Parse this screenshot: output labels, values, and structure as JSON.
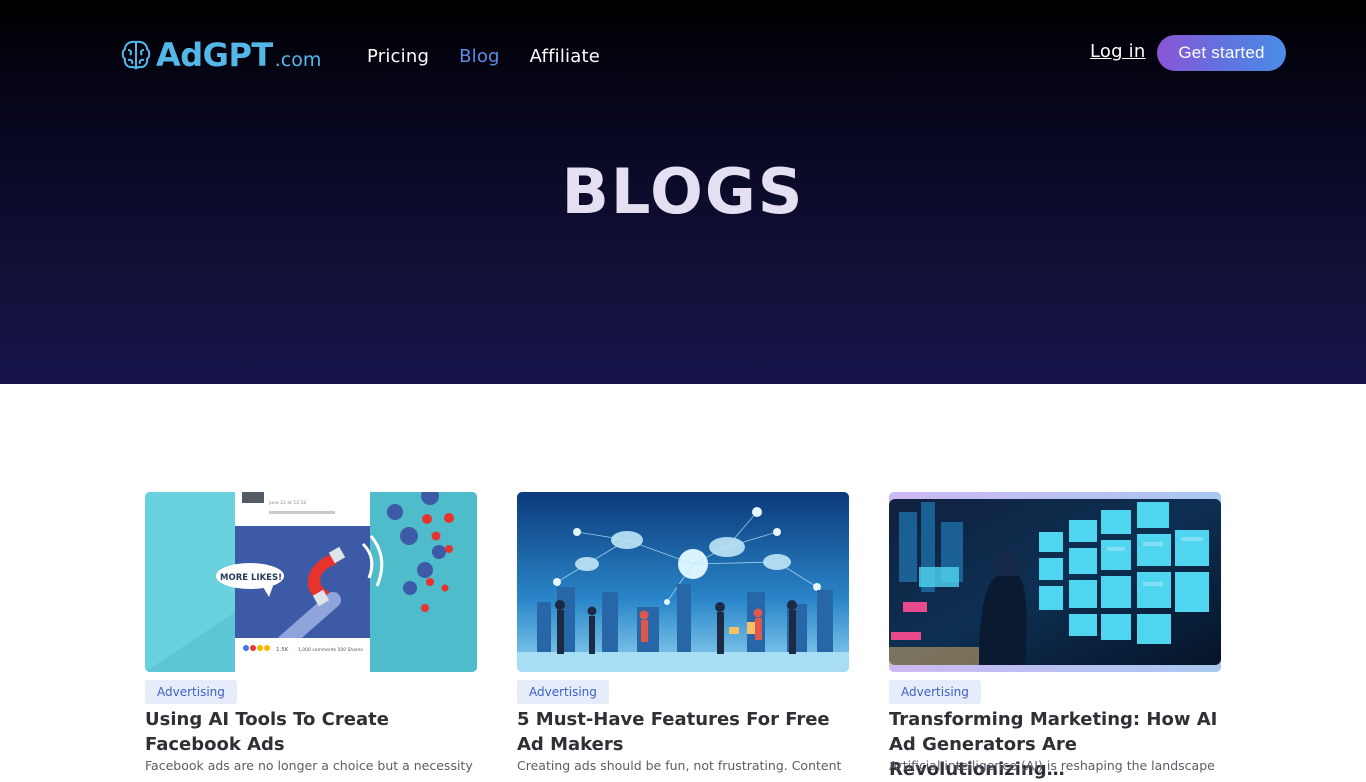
{
  "brand": {
    "name": "AdGPT",
    "suffix": ".com",
    "icon": "brain-icon",
    "color": "#53b8e8"
  },
  "nav": {
    "items": [
      {
        "label": "Pricing",
        "active": false
      },
      {
        "label": "Blog",
        "active": true
      },
      {
        "label": "Affiliate",
        "active": false
      }
    ],
    "login_label": "Log in",
    "cta_label": "Get started"
  },
  "hero": {
    "title": "BLOGS"
  },
  "posts": [
    {
      "category": "Advertising",
      "title": "Using AI Tools To Create Facebook Ads",
      "excerpt": "Facebook ads are no longer a choice but a necessity",
      "image": {
        "caption": "MORE LIKES!",
        "reactions": "1.5K",
        "stats": "1,000 comments 500 Shares",
        "date": "June 22 at 12:32"
      }
    },
    {
      "category": "Advertising",
      "title": "5 Must-Have Features For Free Ad Makers",
      "excerpt": "Creating ads should be fun, not frustrating. Content"
    },
    {
      "category": "Advertising",
      "title": "Transforming Marketing: How AI Ad Generators Are Revolutionizing…",
      "excerpt": "Artificial intelligence (AI) is reshaping the landscape"
    }
  ],
  "colors": {
    "accent": "#5f8be8",
    "tag_bg": "#e6ecf9",
    "tag_text": "#3a64c4"
  }
}
